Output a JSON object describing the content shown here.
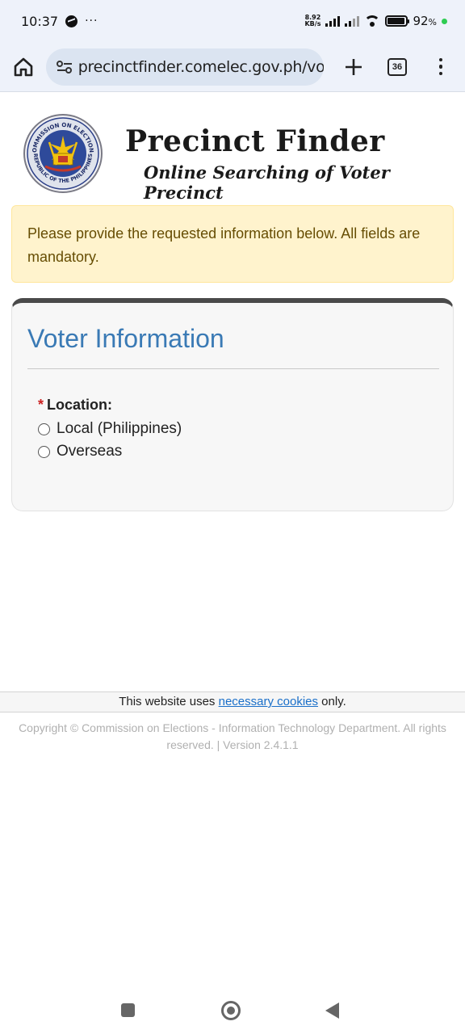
{
  "status_bar": {
    "time": "10:37",
    "more_indicator": "···",
    "net_speed_value": "8.92",
    "net_speed_unit": "KB/s",
    "battery_percent": "92",
    "battery_unit": "%",
    "battery_level": 0.92
  },
  "browser": {
    "url": "precinctfinder.comelec.gov.ph/vote",
    "tab_count": "36"
  },
  "header": {
    "title": "Precinct Finder",
    "subtitle": "Online Searching of Voter Precinct",
    "seal_text_top": "COMMISSION ON ELECTIONS",
    "seal_text_bottom": "REPUBLIC OF THE PHILIPPINES"
  },
  "alert": {
    "message": "Please provide the requested information below. All fields are mandatory."
  },
  "voter_info": {
    "title": "Voter Information",
    "location_required_mark": "*",
    "location_label": "Location:",
    "options": [
      {
        "label": "Local (Philippines)"
      },
      {
        "label": "Overseas"
      }
    ]
  },
  "cookie_notice": {
    "prefix": "This website uses ",
    "link": "necessary cookies",
    "suffix": " only."
  },
  "footer": {
    "copyright": "Copyright © Commission on Elections - Information Technology Department. All rights reserved. | Version 2.4.1.1"
  },
  "colors": {
    "alert_bg": "#fff3cd",
    "alert_text": "#664d03",
    "card_title": "#3a7ab5",
    "required": "#cc2222",
    "link": "#1a6fc9"
  }
}
